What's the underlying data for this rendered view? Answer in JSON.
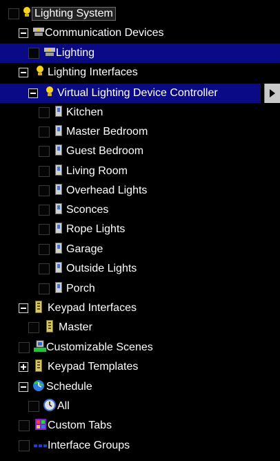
{
  "tree": {
    "root": "Lighting System",
    "communication_devices": "Communication Devices",
    "lighting": "Lighting",
    "lighting_interfaces": "Lighting Interfaces",
    "virtual_controller": "Virtual Lighting Device Controller",
    "devices": [
      "Kitchen",
      "Master Bedroom",
      "Guest Bedroom",
      "Living Room",
      "Overhead Lights",
      "Sconces",
      "Rope Lights",
      "Garage",
      "Outside Lights",
      "Porch"
    ],
    "keypad_interfaces": "Keypad Interfaces",
    "master": "Master",
    "customizable_scenes": "Customizable Scenes",
    "keypad_templates": "Keypad Templates",
    "schedule": "Schedule",
    "all": "All",
    "custom_tabs": "Custom Tabs",
    "interface_groups": "Interface Groups"
  },
  "colors": {
    "selection": "#0a0a86",
    "background": "#000000"
  }
}
